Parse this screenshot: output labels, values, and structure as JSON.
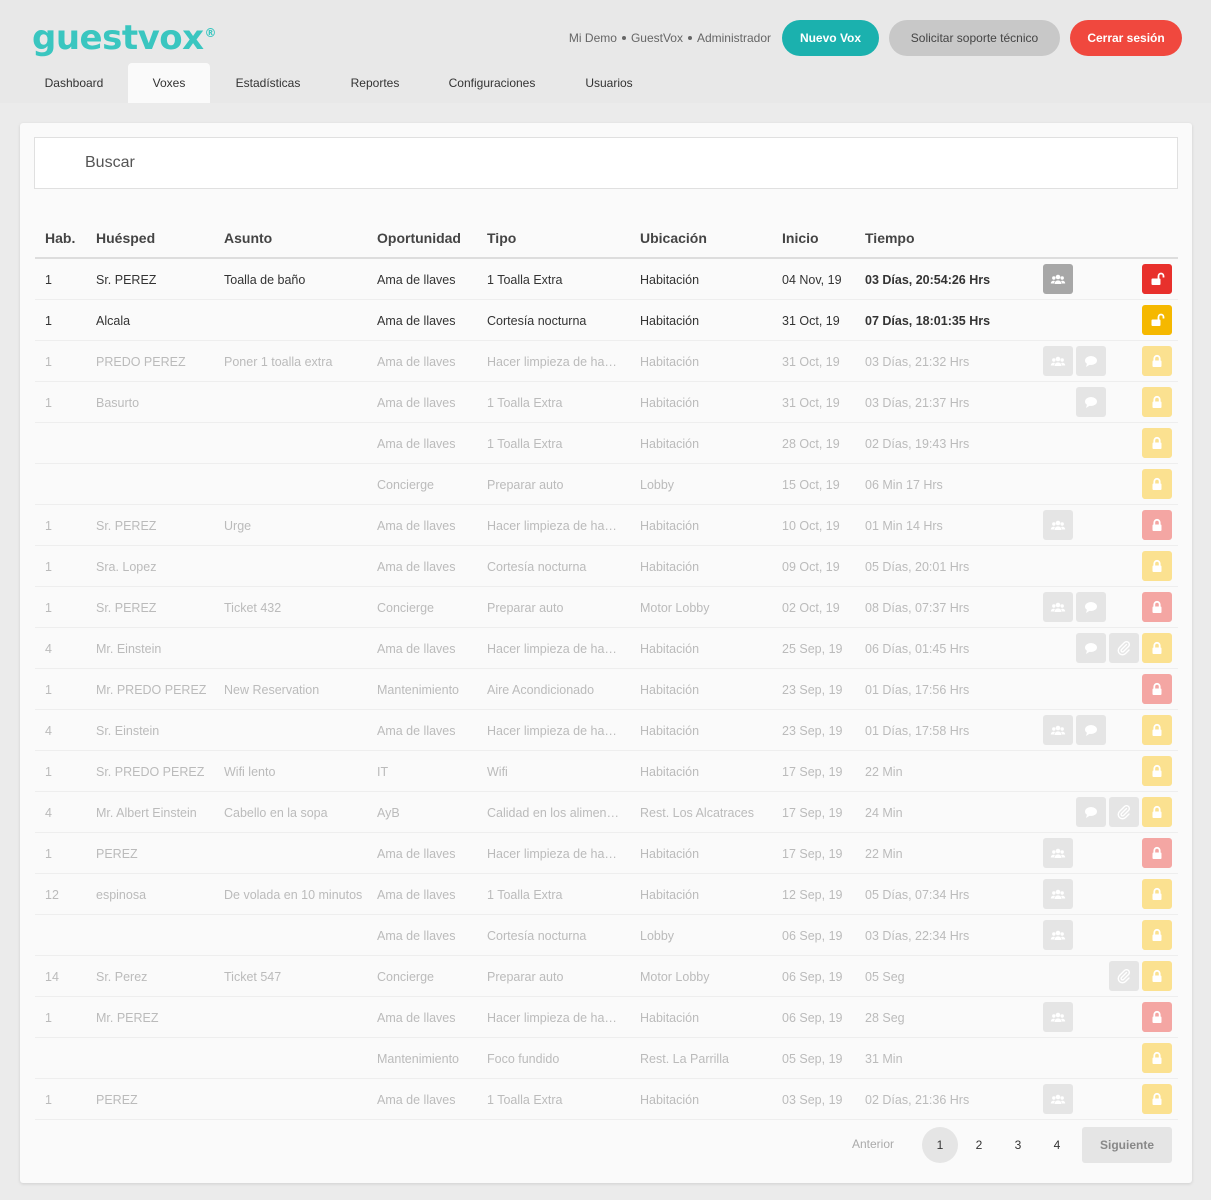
{
  "app": {
    "logo": "guestvox",
    "logo_mark": "®",
    "user_info": [
      "Mi Demo",
      "GuestVox",
      "Administrador"
    ],
    "new_vox_label": "Nuevo Vox",
    "support_label": "Solicitar soporte técnico",
    "logout_label": "Cerrar sesión"
  },
  "tabs": [
    {
      "label": "Dashboard",
      "active": false
    },
    {
      "label": "Voxes",
      "active": true
    },
    {
      "label": "Estadísticas",
      "active": false
    },
    {
      "label": "Reportes",
      "active": false
    },
    {
      "label": "Configuraciones",
      "active": false
    },
    {
      "label": "Usuarios",
      "active": false
    }
  ],
  "search": {
    "placeholder": "Buscar"
  },
  "table": {
    "headers": [
      "Hab.",
      "Huésped",
      "Asunto",
      "Oportunidad",
      "Tipo",
      "Ubicación",
      "Inicio",
      "Tiempo"
    ],
    "rows": [
      {
        "hab": "1",
        "guest": "Sr. PEREZ",
        "subject": "Toalla de baño",
        "opp": "Ama de llaves",
        "type": "1 Toalla Extra",
        "loc": "Habitación",
        "start": "04 Nov, 19",
        "time": "03 Días, 20:54:26 Hrs",
        "active": true,
        "group": true,
        "chat": false,
        "clip": false,
        "lock": "red"
      },
      {
        "hab": "1",
        "guest": "Alcala",
        "subject": "",
        "opp": "Ama de llaves",
        "type": "Cortesía nocturna",
        "loc": "Habitación",
        "start": "31 Oct, 19",
        "time": "07 Días, 18:01:35 Hrs",
        "active": true,
        "group": false,
        "chat": false,
        "clip": false,
        "lock": "yellow"
      },
      {
        "hab": "1",
        "guest": "PREDO PEREZ",
        "subject": "Poner 1 toalla extra",
        "opp": "Ama de llaves",
        "type": "Hacer limpieza de habitación",
        "loc": "Habitación",
        "start": "31 Oct, 19",
        "time": "03 Días, 21:32 Hrs",
        "active": false,
        "group": true,
        "chat": true,
        "clip": false,
        "lock": "yellow"
      },
      {
        "hab": "1",
        "guest": "Basurto",
        "subject": "",
        "opp": "Ama de llaves",
        "type": "1 Toalla Extra",
        "loc": "Habitación",
        "start": "31 Oct, 19",
        "time": "03 Días, 21:37 Hrs",
        "active": false,
        "group": false,
        "chat": true,
        "clip": false,
        "lock": "yellow"
      },
      {
        "hab": "",
        "guest": "",
        "subject": "",
        "opp": "Ama de llaves",
        "type": "1 Toalla Extra",
        "loc": "Habitación",
        "start": "28 Oct, 19",
        "time": "02 Días, 19:43 Hrs",
        "active": false,
        "group": false,
        "chat": false,
        "clip": false,
        "lock": "yellow"
      },
      {
        "hab": "",
        "guest": "",
        "subject": "",
        "opp": "Concierge",
        "type": "Preparar auto",
        "loc": "Lobby",
        "start": "15 Oct, 19",
        "time": "06 Min 17 Hrs",
        "active": false,
        "group": false,
        "chat": false,
        "clip": false,
        "lock": "yellow"
      },
      {
        "hab": "1",
        "guest": "Sr. PEREZ",
        "subject": "Urge",
        "opp": "Ama de llaves",
        "type": "Hacer limpieza de habitación",
        "loc": "Habitación",
        "start": "10 Oct, 19",
        "time": "01 Min 14 Hrs",
        "active": false,
        "group": true,
        "chat": false,
        "clip": false,
        "lock": "red"
      },
      {
        "hab": "1",
        "guest": "Sra. Lopez",
        "subject": "",
        "opp": "Ama de llaves",
        "type": "Cortesía nocturna",
        "loc": "Habitación",
        "start": "09 Oct, 19",
        "time": "05 Días, 20:01 Hrs",
        "active": false,
        "group": false,
        "chat": false,
        "clip": false,
        "lock": "yellow"
      },
      {
        "hab": "1",
        "guest": "Sr. PEREZ",
        "subject": "Ticket 432",
        "opp": "Concierge",
        "type": "Preparar auto",
        "loc": "Motor Lobby",
        "start": "02 Oct, 19",
        "time": "08 Días, 07:37 Hrs",
        "active": false,
        "group": true,
        "chat": true,
        "clip": false,
        "lock": "red"
      },
      {
        "hab": "4",
        "guest": "Mr. Einstein",
        "subject": "",
        "opp": "Ama de llaves",
        "type": "Hacer limpieza de habitación",
        "loc": "Habitación",
        "start": "25 Sep, 19",
        "time": "06 Días, 01:45 Hrs",
        "active": false,
        "group": false,
        "chat": true,
        "clip": true,
        "lock": "yellow"
      },
      {
        "hab": "1",
        "guest": "Mr. PREDO PEREZ",
        "subject": "New Reservation",
        "opp": "Mantenimiento",
        "type": "Aire Acondicionado",
        "loc": "Habitación",
        "start": "23 Sep, 19",
        "time": "01 Días, 17:56 Hrs",
        "active": false,
        "group": false,
        "chat": false,
        "clip": false,
        "lock": "red"
      },
      {
        "hab": "4",
        "guest": "Sr. Einstein",
        "subject": "",
        "opp": "Ama de llaves",
        "type": "Hacer limpieza de habitación",
        "loc": "Habitación",
        "start": "23 Sep, 19",
        "time": "01 Días, 17:58 Hrs",
        "active": false,
        "group": true,
        "chat": true,
        "clip": false,
        "lock": "yellow"
      },
      {
        "hab": "1",
        "guest": "Sr. PREDO PEREZ",
        "subject": "Wifi lento",
        "opp": "IT",
        "type": "Wifi",
        "loc": "Habitación",
        "start": "17 Sep, 19",
        "time": "22 Min",
        "active": false,
        "group": false,
        "chat": false,
        "clip": false,
        "lock": "yellow"
      },
      {
        "hab": "4",
        "guest": "Mr. Albert Einstein",
        "subject": "Cabello en la sopa",
        "opp": "AyB",
        "type": "Calidad en los alimentos",
        "loc": "Rest. Los Alcatraces",
        "start": "17 Sep, 19",
        "time": "24 Min",
        "active": false,
        "group": false,
        "chat": true,
        "clip": true,
        "lock": "yellow"
      },
      {
        "hab": "1",
        "guest": "PEREZ",
        "subject": "",
        "opp": "Ama de llaves",
        "type": "Hacer limpieza de habitación",
        "loc": "Habitación",
        "start": "17 Sep, 19",
        "time": "22 Min",
        "active": false,
        "group": true,
        "chat": false,
        "clip": false,
        "lock": "red"
      },
      {
        "hab": "12",
        "guest": "espinosa",
        "subject": "De volada en 10 minutos",
        "opp": "Ama de llaves",
        "type": "1 Toalla Extra",
        "loc": "Habitación",
        "start": "12 Sep, 19",
        "time": "05 Días, 07:34 Hrs",
        "active": false,
        "group": true,
        "chat": false,
        "clip": false,
        "lock": "yellow"
      },
      {
        "hab": "",
        "guest": "",
        "subject": "",
        "opp": "Ama de llaves",
        "type": "Cortesía nocturna",
        "loc": "Lobby",
        "start": "06 Sep, 19",
        "time": "03 Días, 22:34 Hrs",
        "active": false,
        "group": true,
        "chat": false,
        "clip": false,
        "lock": "yellow"
      },
      {
        "hab": "14",
        "guest": "Sr. Perez",
        "subject": "Ticket 547",
        "opp": "Concierge",
        "type": "Preparar auto",
        "loc": "Motor Lobby",
        "start": "06 Sep, 19",
        "time": "05 Seg",
        "active": false,
        "group": false,
        "chat": false,
        "clip": true,
        "lock": "yellow"
      },
      {
        "hab": "1",
        "guest": "Mr. PEREZ",
        "subject": "",
        "opp": "Ama de llaves",
        "type": "Hacer limpieza de habitación",
        "loc": "Habitación",
        "start": "06 Sep, 19",
        "time": "28 Seg",
        "active": false,
        "group": true,
        "chat": false,
        "clip": false,
        "lock": "red"
      },
      {
        "hab": "",
        "guest": "",
        "subject": "",
        "opp": "Mantenimiento",
        "type": "Foco fundido",
        "loc": "Rest. La Parrilla",
        "start": "05 Sep, 19",
        "time": "31 Min",
        "active": false,
        "group": false,
        "chat": false,
        "clip": false,
        "lock": "yellow"
      },
      {
        "hab": "1",
        "guest": "PEREZ",
        "subject": "",
        "opp": "Ama de llaves",
        "type": "1 Toalla Extra",
        "loc": "Habitación",
        "start": "03 Sep, 19",
        "time": "02 Días, 21:36 Hrs",
        "active": false,
        "group": true,
        "chat": false,
        "clip": false,
        "lock": "yellow"
      }
    ]
  },
  "pagination": {
    "prev_label": "Anterior",
    "pages": [
      "1",
      "2",
      "3",
      "4"
    ],
    "current": "1",
    "next_label": "Siguiente"
  }
}
